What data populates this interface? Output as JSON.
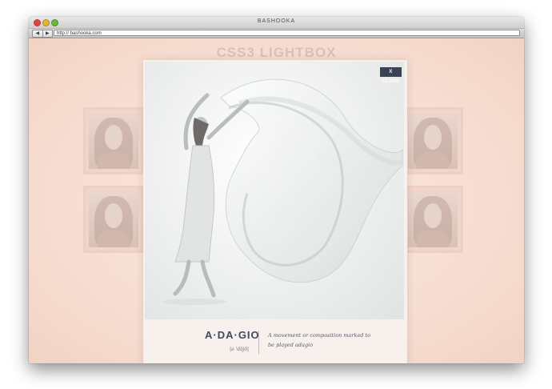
{
  "window": {
    "title": "BASHOOKA"
  },
  "toolbar": {
    "back_label": "◀",
    "forward_label": "▶",
    "url": "http:// bashooka.com"
  },
  "page": {
    "logo_text": "CSS3 LIGHTBOX"
  },
  "lightbox": {
    "close_label": "X CLOSE",
    "word": "A·DA·GIO",
    "pronunciation": "|ə 'däjō|",
    "definition": "A movement or composition marked to be played adagio"
  },
  "colors": {
    "page_bg": "#f6ddd2",
    "close_bg": "#394354",
    "word_text": "#3f4a60"
  },
  "icons": [
    "close-button",
    "back-arrow-icon",
    "forward-arrow-icon"
  ]
}
